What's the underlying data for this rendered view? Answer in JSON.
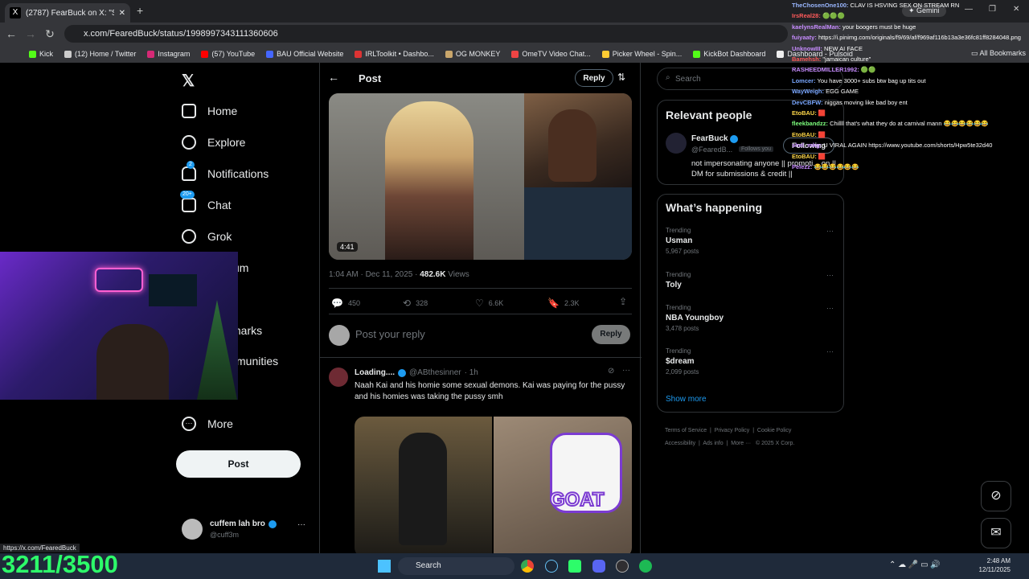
{
  "browser": {
    "tab_title": "(2787) FearBuck on X: \"Streame",
    "url": "x.com/FearedBuck/status/1998997343111360606",
    "bookmarks": [
      "Kick",
      "(12) Home / Twitter",
      "Instagram",
      "(57) YouTube",
      "BAU Official Website",
      "IRLToolkit • Dashbo...",
      "OG MONKEY",
      "OmeTV Video Chat...",
      "Picker Wheel - Spin...",
      "KickBot Dashboard",
      "Dashboard - Pulsoid"
    ],
    "all_bookmarks": "All Bookmarks",
    "gemini": "Gemini",
    "status_url": "https://x.com/FearedBuck"
  },
  "sidebar": {
    "items": [
      {
        "label": "Home",
        "icon": "home-icon"
      },
      {
        "label": "Explore",
        "icon": "search-icon"
      },
      {
        "label": "Notifications",
        "icon": "bell-icon",
        "badge": "2"
      },
      {
        "label": "Chat",
        "icon": "mail-icon",
        "badge": "20+"
      },
      {
        "label": "Grok",
        "icon": "grok-icon"
      },
      {
        "label": "um",
        "icon": ""
      },
      {
        "label": "marks",
        "icon": ""
      },
      {
        "label": "munities",
        "icon": ""
      },
      {
        "label": "More",
        "icon": "more-circle-icon"
      }
    ],
    "post_button": "Post",
    "account": {
      "name": "cuffem lah bro",
      "handle": "@cuff3m"
    }
  },
  "post": {
    "header_title": "Post",
    "reply_button": "Reply",
    "video_duration": "4:41",
    "timestamp": "1:04 AM · Dec 11, 2025 · ",
    "views_count": "482.6K",
    "views_label": "Views",
    "stats": {
      "replies": "450",
      "reposts": "328",
      "likes": "6.6K",
      "bookmarks": "2.3K"
    },
    "reply_placeholder": "Post your reply",
    "reply_submit": "Reply"
  },
  "reply_tweet": {
    "name": "Loading....",
    "handle": "@ABthesinner",
    "time": "· 1h",
    "text": "Naah Kai and his homie some sexual demons. Kai was paying for the pussy and his homies was taking the pussy smh",
    "image_overlay_text": "GOAT"
  },
  "right": {
    "search_placeholder": "Search",
    "relevant_title": "Relevant people",
    "person": {
      "name": "FearBuck",
      "handle": "@FearedB...",
      "follows_you": "Follows you",
      "button": "Following",
      "bio": "not impersonating anyone || promoti... on || DM for submissions & credit ||"
    },
    "happening_title": "What’s happening",
    "trends": [
      {
        "label": "Trending",
        "name": "Usman",
        "count": "5,967 posts"
      },
      {
        "label": "Trending",
        "name": "Toly",
        "count": ""
      },
      {
        "label": "Trending",
        "name": "NBA Youngboy",
        "count": "3,478 posts"
      },
      {
        "label": "Trending",
        "name": "$dream",
        "count": "2,099 posts"
      }
    ],
    "show_more": "Show more",
    "footer": [
      "Terms of Service",
      "Privacy Policy",
      "Cookie Policy",
      "Accessibility",
      "Ads info",
      "More ···",
      "© 2025 X Corp."
    ]
  },
  "chat": [
    {
      "user": "TheChosenOne100:",
      "color": "#9ab7ff",
      "msg": "CLAV IS HSVING SEX ON STREAM RN"
    },
    {
      "user": "IrsReal28:",
      "color": "#ff5a5a",
      "msg": "🟢🟢🟢"
    },
    {
      "user": "kaelynsRealMan:",
      "color": "#c78cff",
      "msg": "your boogers must be huge"
    },
    {
      "user": "fuiyaaty:",
      "color": "#c78cff",
      "msg": "https://i.pinimg.com/originals/f9/69/af/f969af116b13a3e36fc81ff8284048.png"
    },
    {
      "user": "UnknowIII:",
      "color": "#c78cff",
      "msg": "NEW AI FACE"
    },
    {
      "user": "Bamehsh:",
      "color": "#ff5a5a",
      "msg": "\"jamaican culture\""
    },
    {
      "user": "RASHEEDMILLER1992:",
      "color": "#c78cff",
      "msg": "🟢🟢"
    },
    {
      "user": "Lomcer:",
      "color": "#7aa7ff",
      "msg": "You have 3000+ subs btw bag up tits out"
    },
    {
      "user": "WayWeigh:",
      "color": "#7aa7ff",
      "msg": "EGG GAME"
    },
    {
      "user": "DevCBFW:",
      "color": "#7aa7ff",
      "msg": "niggas moving like bad boy ent"
    },
    {
      "user": "EtoBAU:",
      "color": "#ffd84a",
      "msg": "🟥"
    },
    {
      "user": "fleekbandzz:",
      "color": "#7dff7d",
      "msg": "Chillll that's what they do at carnival mann 😂😂😂😂😂😂"
    },
    {
      "user": "EtoBAU:",
      "color": "#ffd84a",
      "msg": "🟥"
    },
    {
      "user": "shel_mkg:",
      "color": "#c78cff",
      "msg": "U VIRAL AGAIN https://www.youtube.com/shorts/Hpw5te32d40"
    },
    {
      "user": "EtoBAU:",
      "color": "#ffd84a",
      "msg": "🟥"
    },
    {
      "user": "Pelezz:",
      "color": "#c78cff",
      "msg": "😂😂😂😂😂😂"
    }
  ],
  "sub_counter": "3211/3500",
  "taskbar": {
    "search": "Search",
    "time": "2:48 AM",
    "date": "12/11/2025"
  },
  "colors": {
    "accent": "#1d9bf0",
    "bg": "#000000",
    "border": "#2f3336",
    "counter": "#2dfc6a"
  }
}
